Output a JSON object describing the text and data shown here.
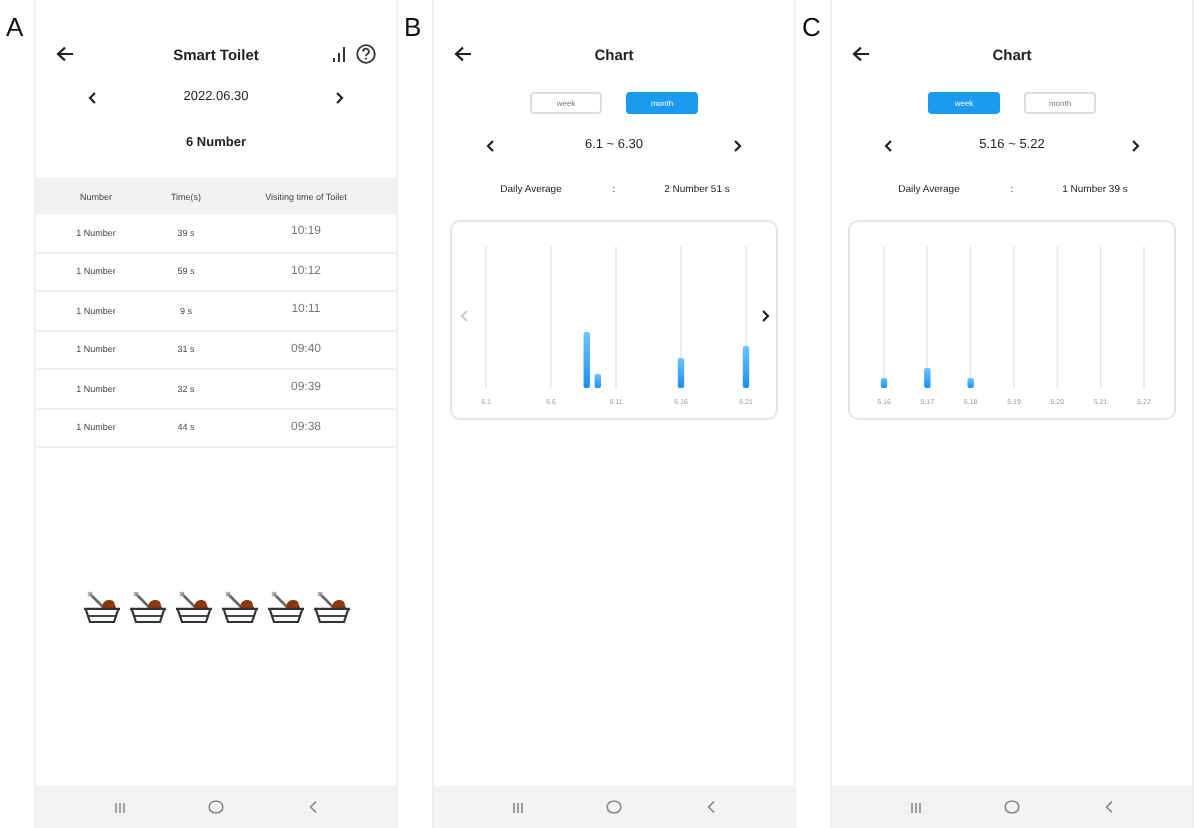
{
  "panels": [
    {
      "label": "A",
      "kind": "records",
      "title": "Smart Toilet",
      "date": "2022.06.30",
      "total": "6 Number",
      "table": {
        "columns": [
          "Number",
          "Time(s)",
          "Visiting time of Toilet"
        ],
        "rows": [
          [
            "1 Number",
            "39 s",
            "10:19"
          ],
          [
            "1 Number",
            "59 s",
            "10:12"
          ],
          [
            "1 Number",
            "9 s",
            "10:11"
          ],
          [
            "1 Number",
            "31 s",
            "09:40"
          ],
          [
            "1 Number",
            "32 s",
            "09:39"
          ],
          [
            "1 Number",
            "44 s",
            "09:38"
          ]
        ]
      },
      "toilet_icons": [
        {
          "kind": "used"
        },
        {
          "kind": "used"
        },
        {
          "kind": "used"
        },
        {
          "kind": "used"
        },
        {
          "kind": "used"
        },
        {
          "kind": "used"
        }
      ]
    },
    {
      "label": "B",
      "kind": "chart",
      "title": "Chart",
      "tabs": [
        {
          "label": "week",
          "selected": false
        },
        {
          "label": "month",
          "selected": true
        }
      ],
      "range": "6.1 ~ 6.30",
      "average": {
        "label": "Daily Average",
        "separator": ":",
        "value": "2 Number 51 s"
      },
      "chart": {
        "categories": [
          "6.1",
          "6.6",
          "6.11",
          "6.16",
          "6.21"
        ],
        "paging": {
          "prev_disabled": true,
          "next_disabled": false
        }
      }
    },
    {
      "label": "C",
      "kind": "chart",
      "title": "Chart",
      "tabs": [
        {
          "label": "week",
          "selected": true
        },
        {
          "label": "month",
          "selected": false
        }
      ],
      "range": "5.16 ~ 5.22",
      "average": {
        "label": "Daily Average",
        "separator": ":",
        "value": "1 Number 39 s"
      },
      "chart": {
        "categories": [
          "5.16",
          "5.17",
          "5.18",
          "5.19",
          "5.20",
          "5.21",
          "5.22"
        ]
      }
    }
  ]
}
